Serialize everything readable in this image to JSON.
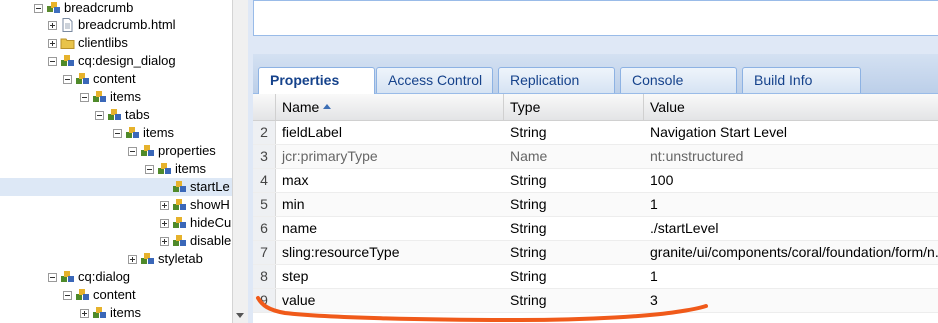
{
  "tree": {
    "nodes": [
      {
        "label": "breadcrumb",
        "toggle": "minus",
        "icon": "component"
      },
      {
        "label": "breadcrumb.html",
        "toggle": "plus",
        "icon": "file"
      },
      {
        "label": "clientlibs",
        "toggle": "plus",
        "icon": "folder"
      },
      {
        "label": "cq:design_dialog",
        "toggle": "minus",
        "icon": "node"
      },
      {
        "label": "content",
        "toggle": "minus",
        "icon": "node"
      },
      {
        "label": "items",
        "toggle": "minus",
        "icon": "node"
      },
      {
        "label": "tabs",
        "toggle": "minus",
        "icon": "node"
      },
      {
        "label": "items",
        "toggle": "minus",
        "icon": "node"
      },
      {
        "label": "properties",
        "toggle": "minus",
        "icon": "node"
      },
      {
        "label": "items",
        "toggle": "minus",
        "icon": "node"
      },
      {
        "label": "startLe",
        "toggle": "none",
        "icon": "node",
        "selected": true
      },
      {
        "label": "showH",
        "toggle": "plus",
        "icon": "node"
      },
      {
        "label": "hideCu",
        "toggle": "plus",
        "icon": "node"
      },
      {
        "label": "disable",
        "toggle": "plus",
        "icon": "node"
      },
      {
        "label": "styletab",
        "toggle": "plus",
        "icon": "node"
      },
      {
        "label": "cq:dialog",
        "toggle": "minus",
        "icon": "node"
      },
      {
        "label": "content",
        "toggle": "minus",
        "icon": "node"
      },
      {
        "label": "items",
        "toggle": "plus",
        "icon": "node"
      }
    ]
  },
  "tabs": [
    {
      "label": "Properties",
      "active": true
    },
    {
      "label": "Access Control",
      "active": false
    },
    {
      "label": "Replication",
      "active": false
    },
    {
      "label": "Console",
      "active": false
    },
    {
      "label": "Build Info",
      "active": false
    }
  ],
  "grid": {
    "headers": {
      "name": "Name",
      "type": "Type",
      "value": "Value"
    },
    "rows": [
      {
        "num": "2",
        "name": "fieldLabel",
        "type": "String",
        "value": "Navigation Start Level"
      },
      {
        "num": "3",
        "name": "jcr:primaryType",
        "type": "Name",
        "value": "nt:unstructured",
        "dim": true
      },
      {
        "num": "4",
        "name": "max",
        "type": "String",
        "value": "100"
      },
      {
        "num": "5",
        "name": "min",
        "type": "String",
        "value": "1"
      },
      {
        "num": "6",
        "name": "name",
        "type": "String",
        "value": "./startLevel"
      },
      {
        "num": "7",
        "name": "sling:resourceType",
        "type": "String",
        "value": "granite/ui/components/coral/foundation/form/n..."
      },
      {
        "num": "8",
        "name": "step",
        "type": "String",
        "value": "1"
      },
      {
        "num": "9",
        "name": "value",
        "type": "String",
        "value": "3"
      }
    ]
  },
  "colors": {
    "annotation": "#f05a1a",
    "tab_text": "#15428b",
    "selection": "#dde8f6"
  }
}
